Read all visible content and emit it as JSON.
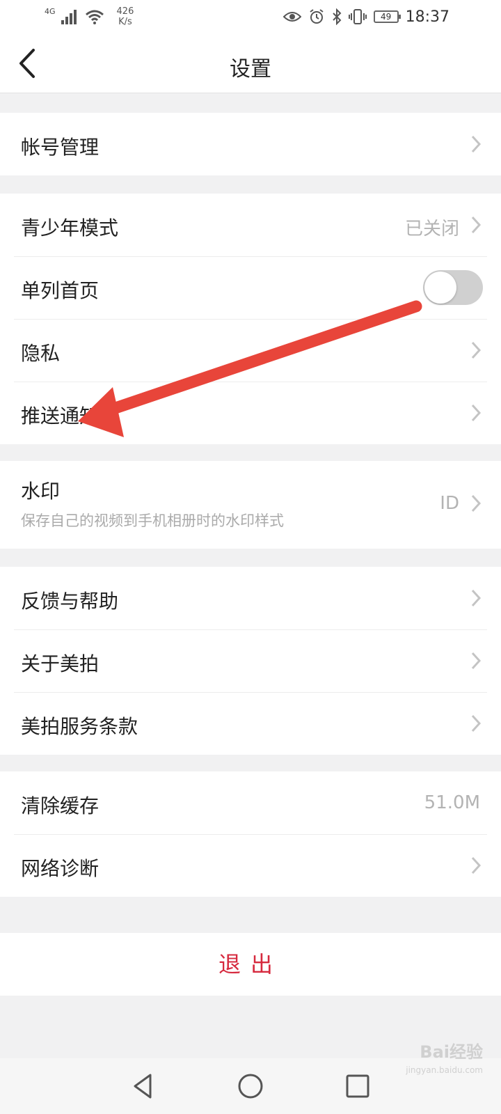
{
  "status_bar": {
    "network": "4G",
    "speed_value": "426",
    "speed_unit": "K/s",
    "battery": "49",
    "time": "18:37"
  },
  "header": {
    "title": "设置"
  },
  "groups": {
    "account": {
      "label": "帐号管理"
    },
    "youth": {
      "label": "青少年模式",
      "value": "已关闭"
    },
    "single_column": {
      "label": "单列首页",
      "toggle_on": false
    },
    "privacy": {
      "label": "隐私"
    },
    "push": {
      "label": "推送通知"
    },
    "watermark": {
      "label": "水印",
      "subtitle": "保存自己的视频到手机相册时的水印样式",
      "value": "ID"
    },
    "feedback": {
      "label": "反馈与帮助"
    },
    "about": {
      "label": "关于美拍"
    },
    "terms": {
      "label": "美拍服务条款"
    },
    "cache": {
      "label": "清除缓存",
      "value": "51.0M"
    },
    "network": {
      "label": "网络诊断"
    }
  },
  "logout": {
    "label": "退出"
  },
  "watermark_logo": {
    "brand": "Bai经验",
    "url": "jingyan.baidu.com"
  },
  "colors": {
    "accent_red": "#d6293e",
    "annotation_arrow": "#e8453a",
    "background": "#f1f1f2"
  }
}
